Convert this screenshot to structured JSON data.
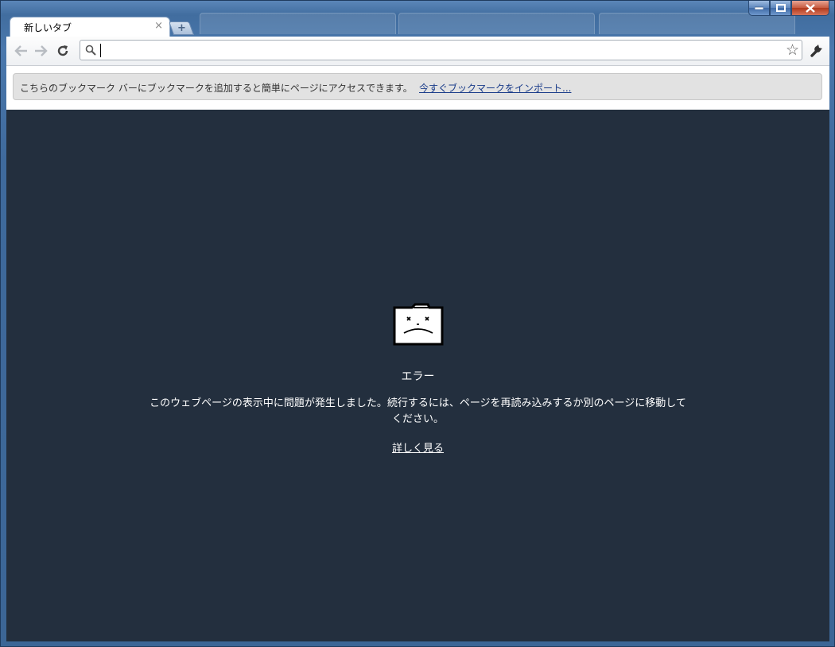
{
  "window": {
    "controls": {
      "minimize": "—",
      "maximize": "□",
      "close": "✕"
    }
  },
  "tabs": [
    {
      "title": "新しいタブ",
      "close": "×",
      "active": true
    }
  ],
  "new_tab": {
    "label": "+"
  },
  "toolbar": {
    "back_icon": "back-arrow-icon",
    "forward_icon": "forward-arrow-icon",
    "reload_icon": "reload-icon",
    "omnibox": {
      "value": "",
      "placeholder": ""
    },
    "star_icon": "bookmark-star-icon",
    "wrench_icon": "wrench-icon"
  },
  "bookmark_bar": {
    "message": "こちらのブックマーク バーにブックマークを追加すると簡単にページにアクセスできます。",
    "import_link": "今すぐブックマークをインポート..."
  },
  "error_page": {
    "title": "エラー",
    "message": "このウェブページの表示中に問題が発生しました。続行するには、ページを再読み込みするか別のページに移動してください。",
    "learn_more": "詳しく見る",
    "icon": "sad-folder-icon"
  },
  "colors": {
    "content_bg": "#232f3e",
    "frame": "#416d9f",
    "link": "#1a3c8a"
  }
}
